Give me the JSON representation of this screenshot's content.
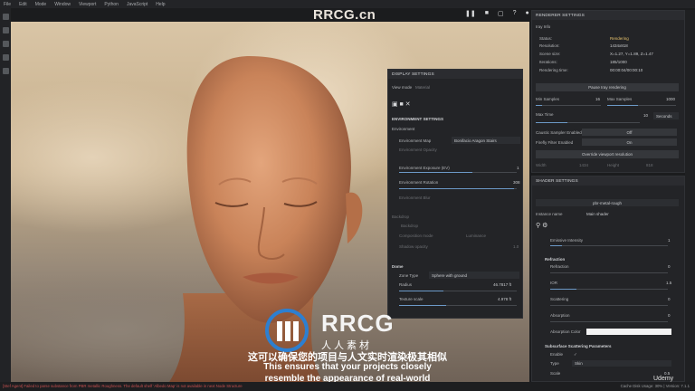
{
  "menu": [
    "File",
    "Edit",
    "Mode",
    "Window",
    "Viewport",
    "Python",
    "JavaScript",
    "Help"
  ],
  "watermark": "RRCG.cn",
  "display_settings": {
    "title": "DISPLAY SETTINGS",
    "tabs": [
      "View mode",
      "Material"
    ],
    "section": "ENVIRONMENT SETTINGS",
    "environment_label": "Environment",
    "environment_map_label": "Environment Map",
    "environment_map_value": "Bonifacio Aragon Stairs",
    "environment_opacity_label": "Environment Opacity",
    "exposure_label": "Environment Exposure (EV)",
    "exposure_value": "1",
    "rotation_label": "Environment Rotation",
    "rotation_value": "308",
    "blur_label": "Environment Blur",
    "blur_value": "0",
    "backdrop_label": "Backdrop",
    "backdrop_check": "Backdrop",
    "composition_label": "Composition mode",
    "composition_value": "Luminance",
    "shadow_label": "Shadow opacity",
    "shadow_value": "1.0",
    "dome_label": "Dome",
    "zone_type_label": "Zone Type",
    "zone_type_value": "Sphere with ground",
    "radius_label": "Radius",
    "radius_value": "46.7817 ft",
    "texture_scale_label": "Texture scale",
    "texture_scale_value": "4.978 ft"
  },
  "renderer_settings": {
    "title": "RENDERER SETTINGS",
    "section": "Iray Info",
    "status_label": "Status:",
    "status_value": "Rendering",
    "resolution_label": "Resolution:",
    "resolution_value": "1434x818",
    "scene_size_label": "Scene size:",
    "scene_size_value": "X=1.27, Y=1.89, Z=1.47",
    "iterations_label": "Iterations:",
    "iterations_value": "185/1000",
    "rendering_time_label": "Rendering time:",
    "rendering_time_value": "00:00:04/00:00:10",
    "pause_button": "Pause Iray rendering",
    "min_samples_label": "Min Samples",
    "min_samples_value": "16",
    "max_samples_label": "Max Samples",
    "max_samples_value": "1000",
    "max_time_label": "Max Time",
    "max_time_value": "10",
    "max_time_unit": "Seconds",
    "caustic_label": "Caustic Sampler Enabled",
    "caustic_value": "Off",
    "firefly_label": "Firefly Filter Enabled",
    "firefly_value": "On",
    "override_button": "Override viewport resolution",
    "width_label": "Width",
    "width_value": "1434",
    "height_label": "Height",
    "height_value": "818"
  },
  "shader_settings": {
    "title": "SHADER SETTINGS",
    "shader_value": "pbr-metal-rough",
    "instance_label": "Instance name",
    "instance_value": "Main shader",
    "emissive_label": "Emissive Intensity",
    "emissive_value": "1",
    "refraction_section": "Refraction",
    "refraction_label": "Refraction",
    "refraction_value": "0",
    "ior_label": "IOR",
    "ior_value": "1.5",
    "scattering_label": "Scattering",
    "scattering_value": "0",
    "absorption_label": "Absorption",
    "absorption_value": "0",
    "absorption_color_label": "Absorption Color",
    "subsurface_section": "Subsurface Scattering Parameters",
    "enable_label": "Enable",
    "type_label": "Type",
    "type_value": "Skin",
    "scale_label": "Scale",
    "scale_value": "0.5"
  },
  "status_bar": {
    "error": "[Stef Agent] Failed to parse substance from PBR metallic Roughness. The default shelf ‘Albedo Map’ is not available in next Node Structure",
    "cache": "Cache Disk Usage:",
    "cache_value": "30% | Version: 7.1.1"
  },
  "brand": "Udemy",
  "logo_text": "RRCG",
  "logo_sub": "人人素材",
  "subtitle_cn": "这可以确保您的项目与人文实时渲染极其相似",
  "subtitle_en_1": "This ensures that your projects closely",
  "subtitle_en_2": "resemble the appearance of real-world",
  "colors": {
    "accent": "#6c99c7",
    "status_rendering": "#e8c36c",
    "error": "#c65050"
  }
}
